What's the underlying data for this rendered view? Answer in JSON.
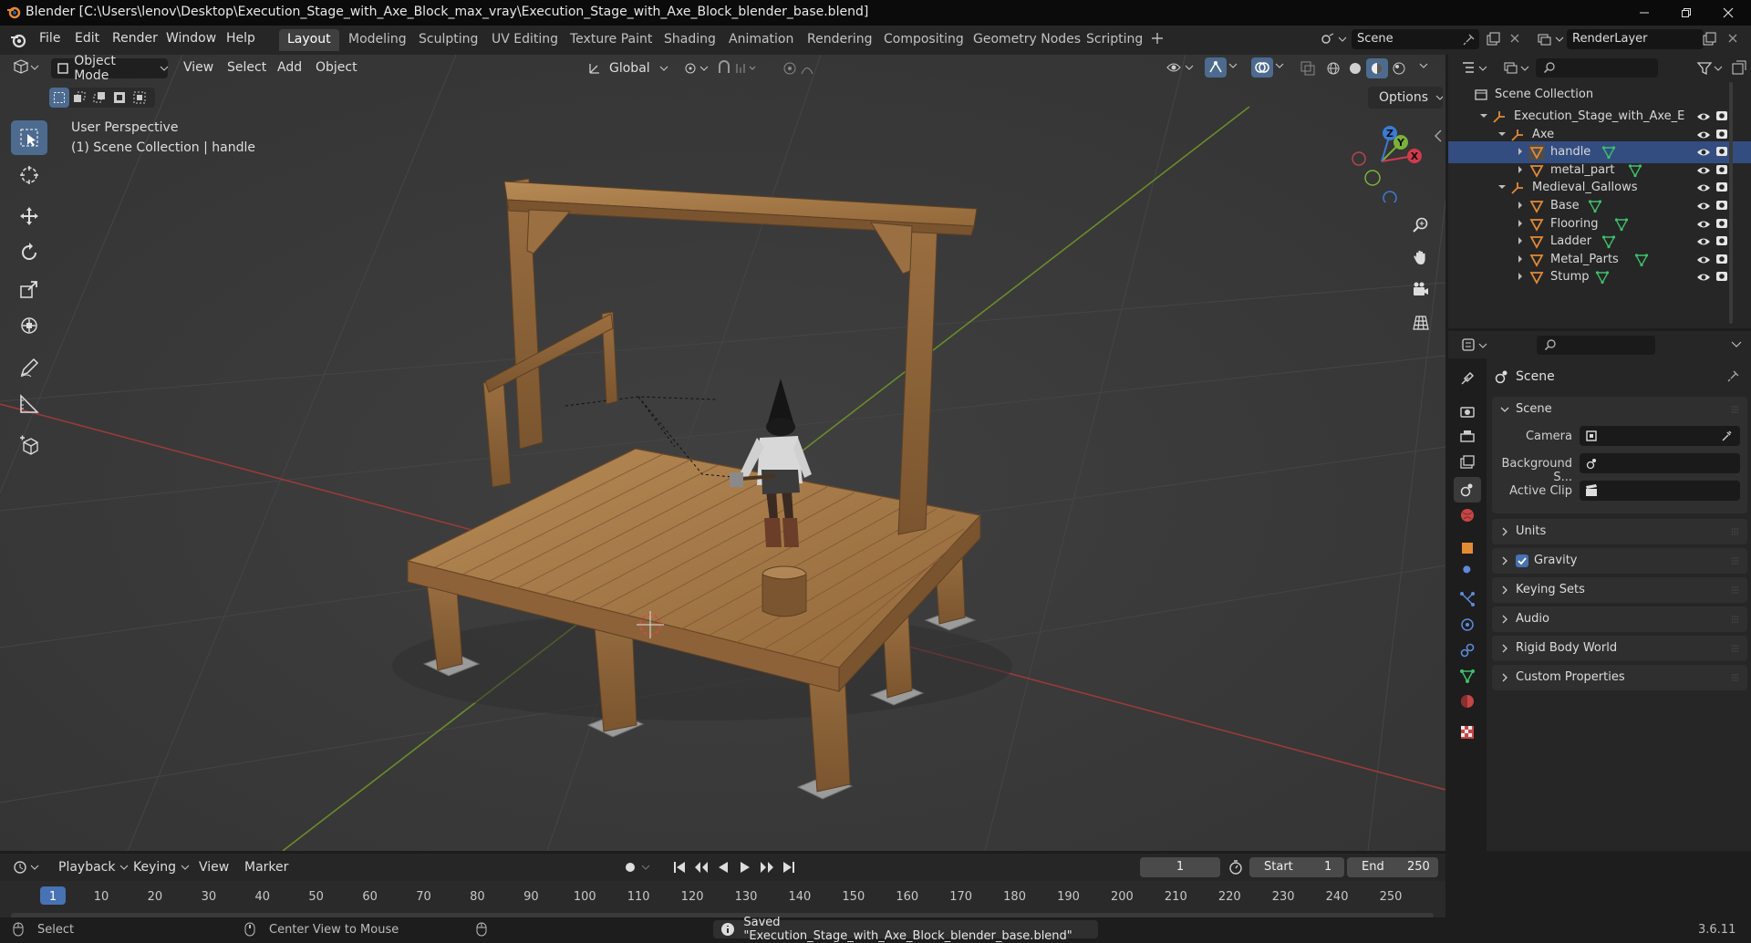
{
  "window": {
    "title": "Blender [C:\\Users\\lenov\\Desktop\\Execution_Stage_with_Axe_Block_max_vray\\Execution_Stage_with_Axe_Block_blender_base.blend]"
  },
  "menu": [
    "File",
    "Edit",
    "Render",
    "Window",
    "Help"
  ],
  "workspaces": [
    "Layout",
    "Modeling",
    "Sculpting",
    "UV Editing",
    "Texture Paint",
    "Shading",
    "Animation",
    "Rendering",
    "Compositing",
    "Geometry Nodes",
    "Scripting"
  ],
  "active_workspace": "Layout",
  "scene_field": "Scene",
  "render_layer_field": "RenderLayer",
  "viewport": {
    "mode": "Object Mode",
    "menus": [
      "View",
      "Select",
      "Add",
      "Object"
    ],
    "transform_orientation": "Global",
    "options_label": "Options",
    "overlay_title": "User Perspective",
    "overlay_subtitle": "(1) Scene Collection | handle",
    "gizmo_axes": {
      "x": "X",
      "y": "Y",
      "z": "Z"
    }
  },
  "outliner": {
    "root": "Scene Collection",
    "rows": [
      {
        "label": "Execution_Stage_with_Axe_E",
        "kind": "collection"
      },
      {
        "label": "Axe",
        "kind": "collection"
      },
      {
        "label": "handle",
        "kind": "mesh"
      },
      {
        "label": "metal_part",
        "kind": "mesh"
      },
      {
        "label": "Medieval_Gallows",
        "kind": "collection"
      },
      {
        "label": "Base",
        "kind": "mesh"
      },
      {
        "label": "Flooring",
        "kind": "mesh"
      },
      {
        "label": "Ladder",
        "kind": "mesh"
      },
      {
        "label": "Metal_Parts",
        "kind": "mesh"
      },
      {
        "label": "Stump",
        "kind": "mesh"
      }
    ]
  },
  "properties": {
    "context": "Scene",
    "section": "Scene",
    "fields": [
      {
        "label": "Camera",
        "value": ""
      },
      {
        "label": "Background S...",
        "value": ""
      },
      {
        "label": "Active Clip",
        "value": ""
      }
    ],
    "panels": [
      "Units",
      "Gravity",
      "Keying Sets",
      "Audio",
      "Rigid Body World",
      "Custom Properties"
    ],
    "gravity_checked": true
  },
  "timeline": {
    "menus": [
      "Playback",
      "Keying",
      "View",
      "Marker"
    ],
    "current_frame": "1",
    "start_label": "Start",
    "start_value": "1",
    "end_label": "End",
    "end_value": "250",
    "ticks": [
      "1",
      "10",
      "20",
      "30",
      "40",
      "50",
      "60",
      "70",
      "80",
      "90",
      "100",
      "110",
      "120",
      "130",
      "140",
      "150",
      "160",
      "170",
      "180",
      "190",
      "200",
      "210",
      "220",
      "230",
      "240",
      "250"
    ]
  },
  "status": {
    "select": "Select",
    "center_view": "Center View to Mouse",
    "message": "Saved \"Execution_Stage_with_Axe_Block_blender_base.blend\"",
    "version": "3.6.11"
  },
  "colors": {
    "accent": "#4c6b8f",
    "selected_frame": "#4772b3",
    "x_axis": "#9a3a3a",
    "y_axis": "#6a8c2a",
    "wood": "#a97a47"
  }
}
